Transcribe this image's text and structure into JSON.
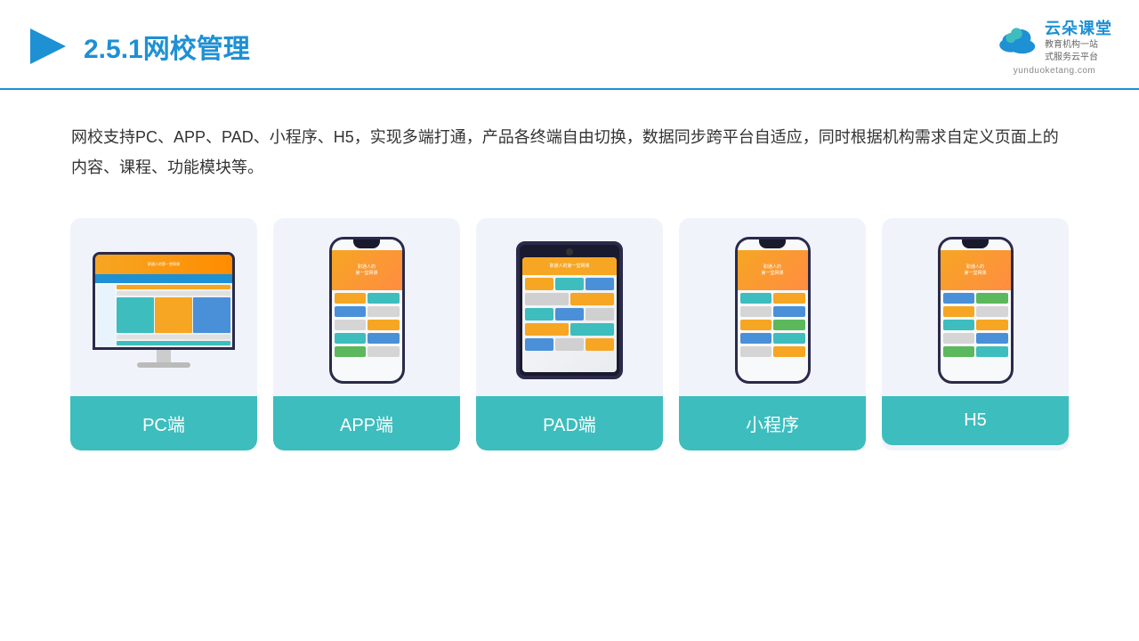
{
  "header": {
    "title_prefix": "2.5.1",
    "title_main": "网校管理",
    "logo_text": "云朵课堂",
    "logo_url": "yunduoketang.com",
    "logo_service": "教育机构一站\n式服务云平台"
  },
  "description": {
    "text": "网校支持PC、APP、PAD、小程序、H5，实现多端打通，产品各终端自由切换，数据同步跨平台自适应，同时根据机构需求自定义页面上的内容、课程、功能模块等。"
  },
  "cards": [
    {
      "id": "pc",
      "label": "PC端"
    },
    {
      "id": "app",
      "label": "APP端"
    },
    {
      "id": "pad",
      "label": "PAD端"
    },
    {
      "id": "miniprogram",
      "label": "小程序"
    },
    {
      "id": "h5",
      "label": "H5"
    }
  ]
}
